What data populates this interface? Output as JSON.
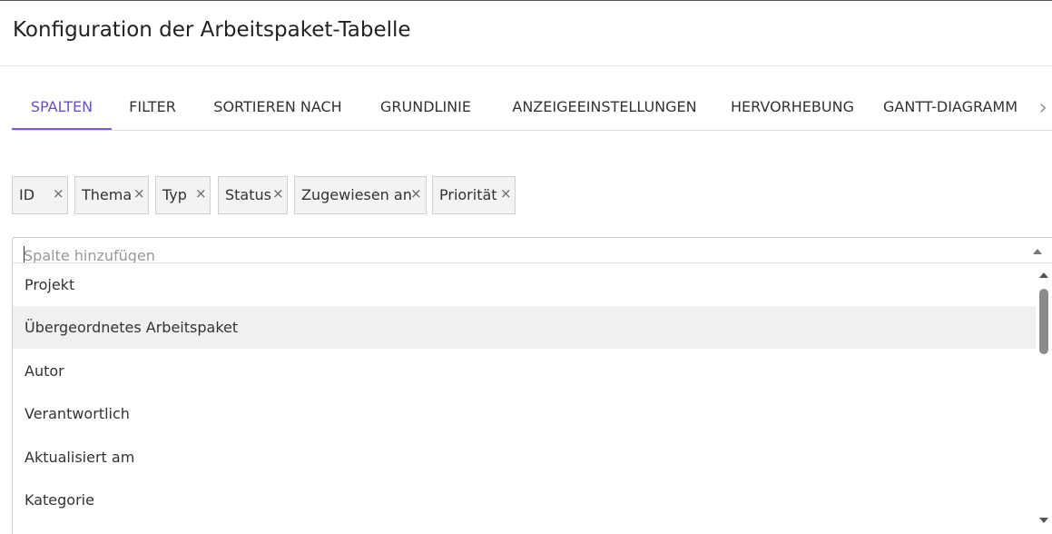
{
  "modal": {
    "title": "Konfiguration der Arbeitspaket-Tabelle"
  },
  "tabs": [
    {
      "label": "SPALTEN",
      "active": true
    },
    {
      "label": "FILTER",
      "active": false
    },
    {
      "label": "SORTIEREN NACH",
      "active": false
    },
    {
      "label": "GRUNDLINIE",
      "active": false
    },
    {
      "label": "ANZEIGEEINSTELLUNGEN",
      "active": false
    },
    {
      "label": "HERVORHEBUNG",
      "active": false
    },
    {
      "label": "GANTT-DIAGRAMM",
      "active": false
    }
  ],
  "tab_next_icon": "›",
  "selected_columns": [
    {
      "label": "ID",
      "remove": "×"
    },
    {
      "label": "Thema",
      "remove": "×"
    },
    {
      "label": "Typ",
      "remove": "×"
    },
    {
      "label": "Status",
      "remove": "×"
    },
    {
      "label": "Zugewiesen an",
      "remove": "×"
    },
    {
      "label": "Priorität",
      "remove": "×"
    }
  ],
  "column_select": {
    "placeholder": "Spalte hinzufügen",
    "value": ""
  },
  "options": [
    {
      "label": "Projekt",
      "highlighted": false
    },
    {
      "label": "Übergeordnetes Arbeitspaket",
      "highlighted": true
    },
    {
      "label": "Autor",
      "highlighted": false
    },
    {
      "label": "Verantwortlich",
      "highlighted": false
    },
    {
      "label": "Aktualisiert am",
      "highlighted": false
    },
    {
      "label": "Kategorie",
      "highlighted": false
    }
  ],
  "colors": {
    "accent": "#6a4fc7",
    "chip_background": "#f3f3f3",
    "highlight_background": "#f0f0f0"
  }
}
